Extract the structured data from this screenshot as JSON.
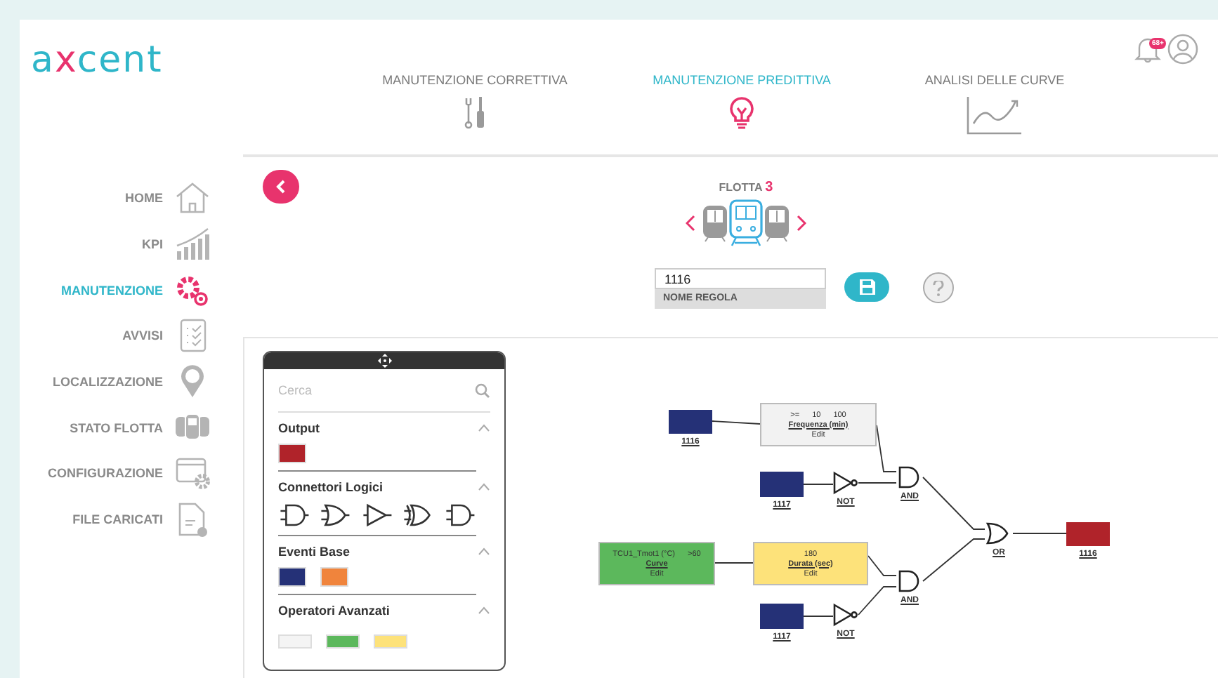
{
  "logo": [
    "a",
    "x",
    "cent"
  ],
  "notifications": {
    "badge": "68+"
  },
  "tabs": [
    {
      "label": "MANUTENZIONE CORRETTIVA",
      "selected": false
    },
    {
      "label": "MANUTENZIONE PREDITTIVA",
      "selected": true
    },
    {
      "label": "ANALISI DELLE CURVE",
      "selected": false
    }
  ],
  "sidebar": {
    "items": [
      {
        "label": "HOME",
        "selected": false
      },
      {
        "label": "KPI",
        "selected": false
      },
      {
        "label": "MANUTENZIONE",
        "selected": true
      },
      {
        "label": "AVVISI",
        "selected": false
      },
      {
        "label": "LOCALIZZAZIONE",
        "selected": false
      },
      {
        "label": "STATO FLOTTA",
        "selected": false
      },
      {
        "label": "CONFIGURAZIONE",
        "selected": false
      },
      {
        "label": "FILE CARICATI",
        "selected": false
      }
    ]
  },
  "fleet": {
    "title": "FLOTTA",
    "number": "3"
  },
  "rule": {
    "value": "1116",
    "label": "NOME REGOLA"
  },
  "palette": {
    "search": {
      "placeholder": "Cerca"
    },
    "sections": [
      {
        "title": "Output",
        "expanded": true,
        "items": [
          {
            "kind": "block",
            "color": "#b0232a"
          }
        ]
      },
      {
        "title": "Connettori Logici",
        "expanded": true,
        "items": [
          {
            "kind": "and"
          },
          {
            "kind": "or"
          },
          {
            "kind": "buffer"
          },
          {
            "kind": "xor"
          },
          {
            "kind": "and"
          }
        ]
      },
      {
        "title": "Eventi Base",
        "expanded": true,
        "items": [
          {
            "kind": "block",
            "color": "#253177"
          },
          {
            "kind": "block",
            "color": "#f0843c"
          }
        ]
      },
      {
        "title": "Operatori Avanzati",
        "expanded": true,
        "items": [
          {
            "kind": "block",
            "color": "#f4f4f4"
          },
          {
            "kind": "block",
            "color": "#5cb85c"
          },
          {
            "kind": "block",
            "color": "#fde27a"
          }
        ]
      }
    ]
  },
  "diagram": {
    "nodes": [
      {
        "kind": "event",
        "color": "#253177",
        "label": "1116"
      },
      {
        "kind": "operator",
        "color": "#f2f2f2",
        "values": [
          ">=",
          "10",
          "100"
        ],
        "title": "Frequenza (min)",
        "action": "Edit"
      },
      {
        "kind": "event",
        "color": "#253177",
        "label": "1117"
      },
      {
        "kind": "not",
        "label": "NOT"
      },
      {
        "kind": "and",
        "label": "AND"
      },
      {
        "kind": "operator",
        "color": "#5cb85c",
        "values": [
          "TCU1_Tmot1 (°C)",
          ">60"
        ],
        "title": "Curve",
        "action": "Edit"
      },
      {
        "kind": "operator",
        "color": "#fde27a",
        "values": [
          "180"
        ],
        "title": "Durata (sec)",
        "action": "Edit"
      },
      {
        "kind": "event",
        "color": "#253177",
        "label": "1117"
      },
      {
        "kind": "not",
        "label": "NOT"
      },
      {
        "kind": "and",
        "label": "AND"
      },
      {
        "kind": "or",
        "label": "OR"
      },
      {
        "kind": "output",
        "color": "#b0232a",
        "label": "1116"
      }
    ]
  }
}
